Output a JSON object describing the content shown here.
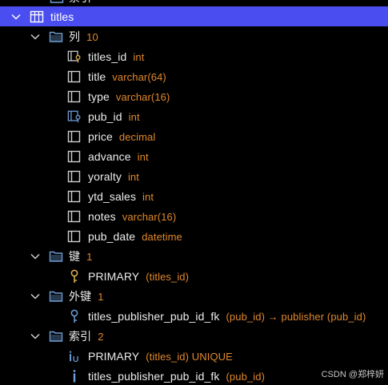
{
  "tree": {
    "partial_top_label": "索引",
    "table": {
      "name": "titles"
    },
    "columns_group": {
      "label": "列",
      "count": "10"
    },
    "columns": [
      {
        "name": "titles_id",
        "type": "int",
        "icon": "primary-key-column-icon"
      },
      {
        "name": "title",
        "type": "varchar(64)",
        "icon": "column-icon"
      },
      {
        "name": "type",
        "type": "varchar(16)",
        "icon": "column-icon"
      },
      {
        "name": "pub_id",
        "type": "int",
        "icon": "foreign-key-column-icon"
      },
      {
        "name": "price",
        "type": "decimal",
        "icon": "column-icon"
      },
      {
        "name": "advance",
        "type": "int",
        "icon": "column-icon"
      },
      {
        "name": "yoralty",
        "type": "int",
        "icon": "column-icon"
      },
      {
        "name": "ytd_sales",
        "type": "int",
        "icon": "column-icon"
      },
      {
        "name": "notes",
        "type": "varchar(16)",
        "icon": "column-icon"
      },
      {
        "name": "pub_date",
        "type": "datetime",
        "icon": "column-icon"
      }
    ],
    "keys_group": {
      "label": "键",
      "count": "1"
    },
    "keys": [
      {
        "name": "PRIMARY",
        "detail": "(titles_id)"
      }
    ],
    "fk_group": {
      "label": "外键",
      "count": "1"
    },
    "foreign_keys": [
      {
        "name": "titles_publisher_pub_id_fk",
        "detail": "(pub_id) → publisher (pub_id)"
      }
    ],
    "index_group": {
      "label": "索引",
      "count": "2"
    },
    "indexes": [
      {
        "name": "PRIMARY",
        "detail": "(titles_id) UNIQUE",
        "icon": "unique-index-icon"
      },
      {
        "name": "titles_publisher_pub_id_fk",
        "detail": "(pub_id)",
        "icon": "index-icon"
      }
    ]
  },
  "watermark": "CSDN @郑梓妍",
  "colors": {
    "background": "#000000",
    "selection": "#4a4ef0",
    "meta_text": "#e0882a",
    "folder_icon": "#6f9fd8",
    "key_icon": "#e0b64a",
    "index_icon": "#6f9fd8"
  }
}
